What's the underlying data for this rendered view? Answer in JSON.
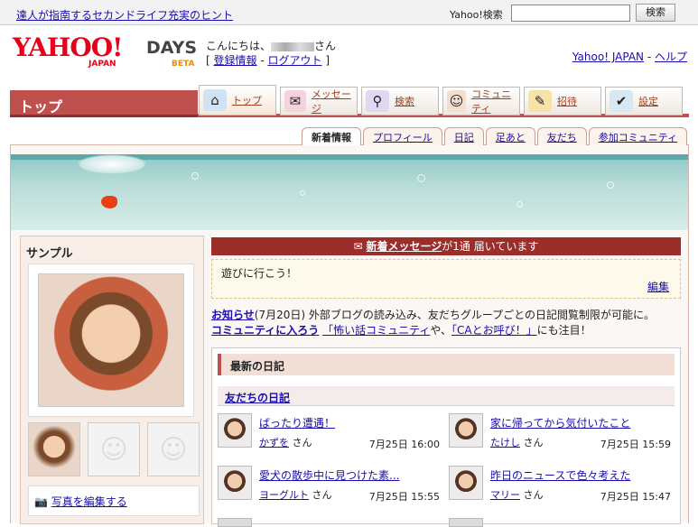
{
  "topbar": {
    "hint_link": "達人が指南するセカンドライフ充実のヒント",
    "search_label": "Yahoo!検索",
    "search_button": "検索",
    "search_value": ""
  },
  "brand": {
    "logo": "YAHOO!",
    "japan": "JAPAN",
    "days": "DAYS",
    "beta": "BETA"
  },
  "greeting": {
    "hello": "こんにちは、",
    "san": "さん",
    "register": "登録情報",
    "logout": "ログアウト"
  },
  "toplinks": {
    "yahoo_japan": "Yahoo! JAPAN",
    "sep": " - ",
    "help": "ヘルプ"
  },
  "nav": {
    "page_title": "トップ",
    "items": [
      {
        "label": "トップ",
        "icon": "house-icon"
      },
      {
        "label": "メッセージ",
        "icon": "envelope-icon"
      },
      {
        "label": "検索",
        "icon": "magnifier-icon"
      },
      {
        "label": "コミュニティ",
        "icon": "people-icon"
      },
      {
        "label": "招待",
        "icon": "invite-icon"
      },
      {
        "label": "設定",
        "icon": "settings-icon"
      }
    ]
  },
  "subtabs": [
    "新着情報",
    "プロフィール",
    "日記",
    "足あと",
    "友だち",
    "参加コミュニティ"
  ],
  "profile": {
    "name": "サンプル",
    "edit_photos": "写真を編集する"
  },
  "message": {
    "link": "新着メッセージ",
    "text": "が1通 届いています",
    "body": "遊びに行こう！",
    "edit": "編集"
  },
  "news": {
    "label": "お知らせ",
    "date": "(7月20日)",
    "text": "外部ブログの読み込み、友だちグループごとの日記閲覧制限が可能に。",
    "community_link": "コミュニティに入ろう",
    "comm1": "「怖い話コミュニティ",
    "mid": "や、",
    "comm2": "「CAとお呼び！」",
    "tail": "にも注目！"
  },
  "diary": {
    "header": "最新の日記",
    "friends": "友だちの日記",
    "entries": [
      {
        "title": "ばったり遭遇！",
        "author": "かずを",
        "san": "さん",
        "date": "7月25日 16:00"
      },
      {
        "title": "家に帰ってから気付いたこと",
        "author": "たけし",
        "san": "さん",
        "date": "7月25日 15:59"
      },
      {
        "title": "愛犬の散歩中に見つけた素...",
        "author": "ヨーグルト",
        "san": "さん",
        "date": "7月25日 15:55"
      },
      {
        "title": "昨日のニュースで色々考えた",
        "author": "マリー",
        "san": "さん",
        "date": "7月25日 15:47"
      }
    ]
  },
  "colors": {
    "accent": "#c0504d",
    "dark_accent": "#9b2d2a",
    "link": "#1a0dab",
    "water": "#8fc6c6"
  }
}
